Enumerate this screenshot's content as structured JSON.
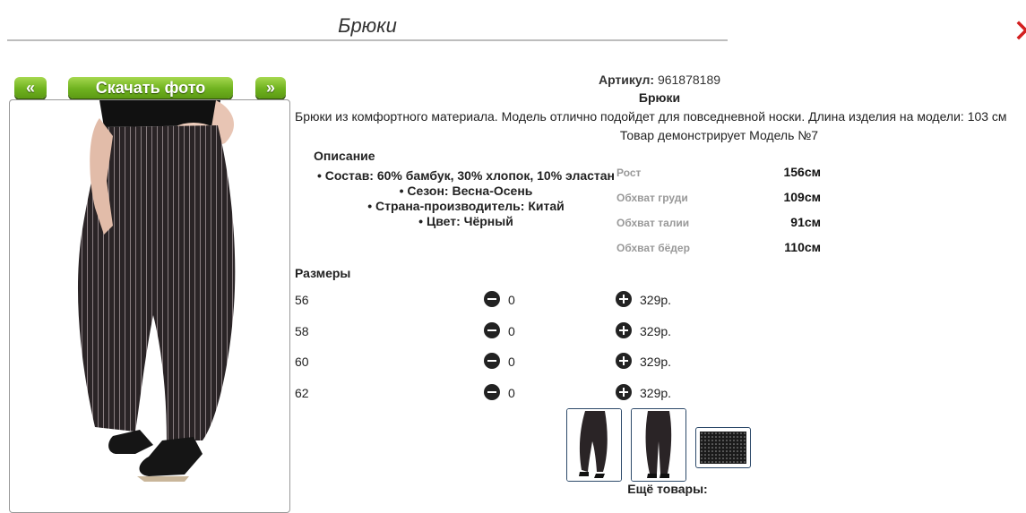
{
  "page": {
    "title": "Брюки"
  },
  "nav": {
    "prev_label": "«",
    "download_label": "Скачать фото",
    "next_label": "»"
  },
  "product": {
    "sku_label": "Артикул:",
    "sku_value": "961878189",
    "name": "Брюки",
    "description": "Брюки из комфортного материала. Модель отлично подойдет для повседневной носки. Длина изделия на модели: 103 см",
    "model_note": "Товар демонстрирует Модель №7"
  },
  "specs": {
    "heading": "Описание",
    "items": [
      "Состав: 60% бамбук, 30% хлопок, 10% эластан",
      "Сезон: Весна-Осень",
      "Страна-производитель: Китай",
      "Цвет: Чёрный"
    ]
  },
  "measurements": [
    {
      "label": "Рост",
      "value": "156см"
    },
    {
      "label": "Обхват груди",
      "value": "109см"
    },
    {
      "label": "Обхват талии",
      "value": "91см"
    },
    {
      "label": "Обхват бёдер",
      "value": "110см"
    }
  ],
  "sizes": {
    "heading": "Размеры",
    "rows": [
      {
        "size": "56",
        "qty": "0",
        "price": "329р."
      },
      {
        "size": "58",
        "qty": "0",
        "price": "329р."
      },
      {
        "size": "60",
        "qty": "0",
        "price": "329р."
      },
      {
        "size": "62",
        "qty": "0",
        "price": "329р."
      }
    ]
  },
  "more_heading": "Ещё товары:",
  "colors": {
    "accent_green": "#6fb21f",
    "close_red": "#d31f1f"
  }
}
